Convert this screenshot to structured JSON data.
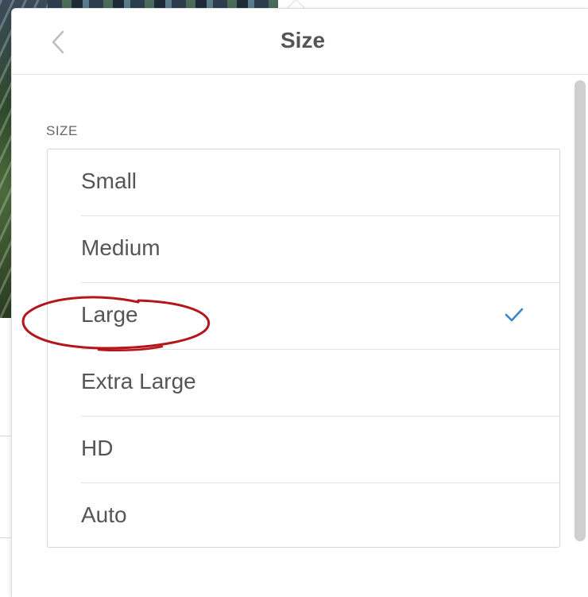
{
  "header": {
    "title": "Size",
    "back_icon": "chevron-left-icon"
  },
  "section": {
    "label": "SIZE"
  },
  "options": [
    {
      "label": "Small",
      "selected": false
    },
    {
      "label": "Medium",
      "selected": false
    },
    {
      "label": "Large",
      "selected": true
    },
    {
      "label": "Extra Large",
      "selected": false
    },
    {
      "label": "HD",
      "selected": false
    },
    {
      "label": "Auto",
      "selected": false
    }
  ],
  "colors": {
    "accent": "#3a86c8",
    "annotation": "#b3161b",
    "text": "#555555"
  }
}
